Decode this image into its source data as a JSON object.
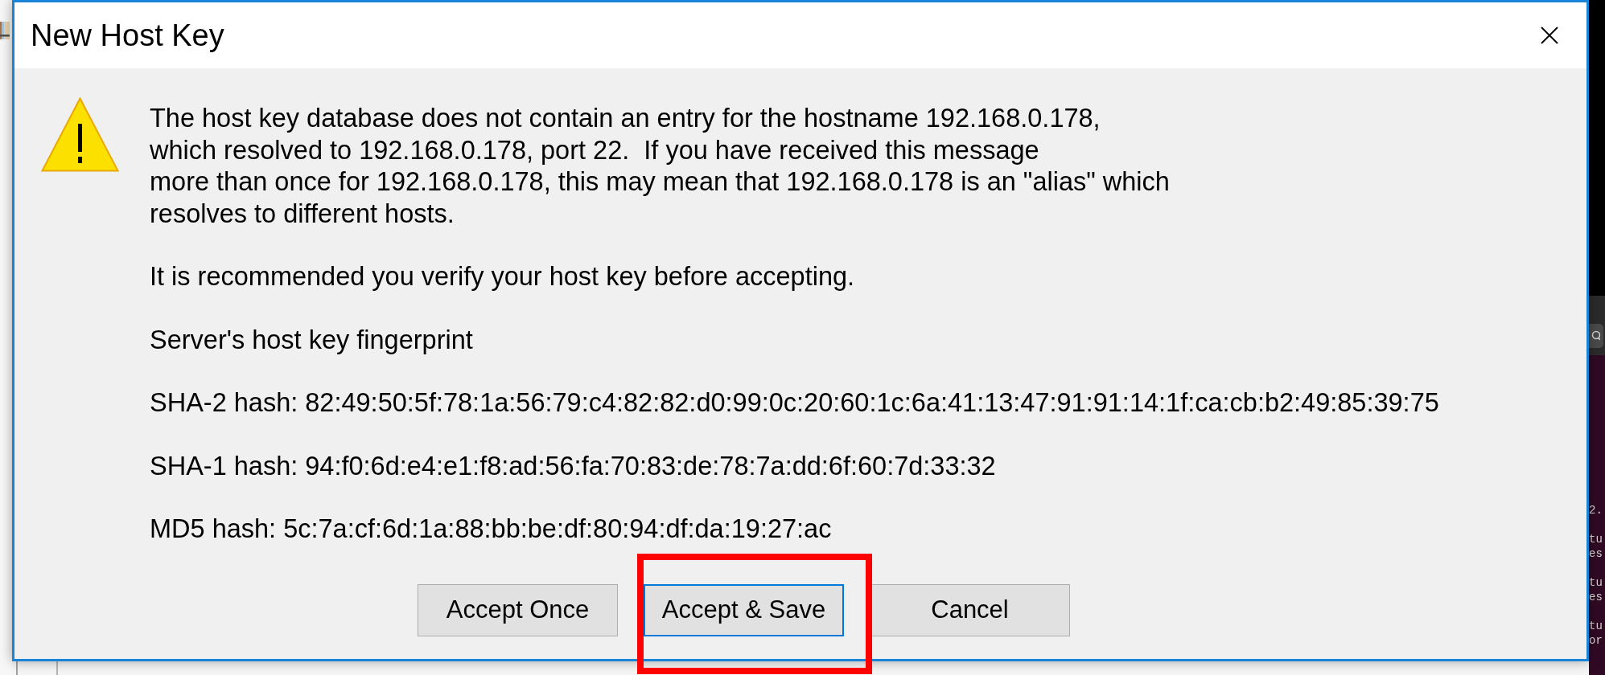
{
  "dialog": {
    "title": "New Host Key",
    "message": [
      "The host key database does not contain an entry for the hostname 192.168.0.178,\nwhich resolved to 192.168.0.178, port 22.  If you have received this message\nmore than once for 192.168.0.178, this may mean that 192.168.0.178 is an \"alias\" which\nresolves to different hosts.",
      "It is recommended you verify your host key before accepting."
    ],
    "fingerprint": {
      "heading": "Server's host key fingerprint",
      "hashes": [
        "SHA-2 hash: 82:49:50:5f:78:1a:56:79:c4:82:82:d0:99:0c:20:60:1c:6a:41:13:47:91:91:14:1f:ca:cb:b2:49:85:39:75",
        "SHA-1 hash: 94:f0:6d:e4:e1:f8:ad:56:fa:70:83:de:78:7a:dd:6f:60:7d:33:32",
        "MD5 hash: 5c:7a:cf:6d:1a:88:bb:be:df:80:94:df:da:19:27:ac"
      ]
    },
    "buttons": [
      {
        "label": "Accept Once",
        "focused": false,
        "highlighted": false
      },
      {
        "label": "Accept & Save",
        "focused": true,
        "highlighted": true
      },
      {
        "label": "Cancel",
        "focused": false,
        "highlighted": false
      }
    ]
  },
  "background_terminal": {
    "line_groups": [
      [
        "2."
      ],
      [
        "tu",
        "es"
      ],
      [
        "tu",
        "es"
      ],
      [
        "tu",
        "or"
      ]
    ]
  }
}
